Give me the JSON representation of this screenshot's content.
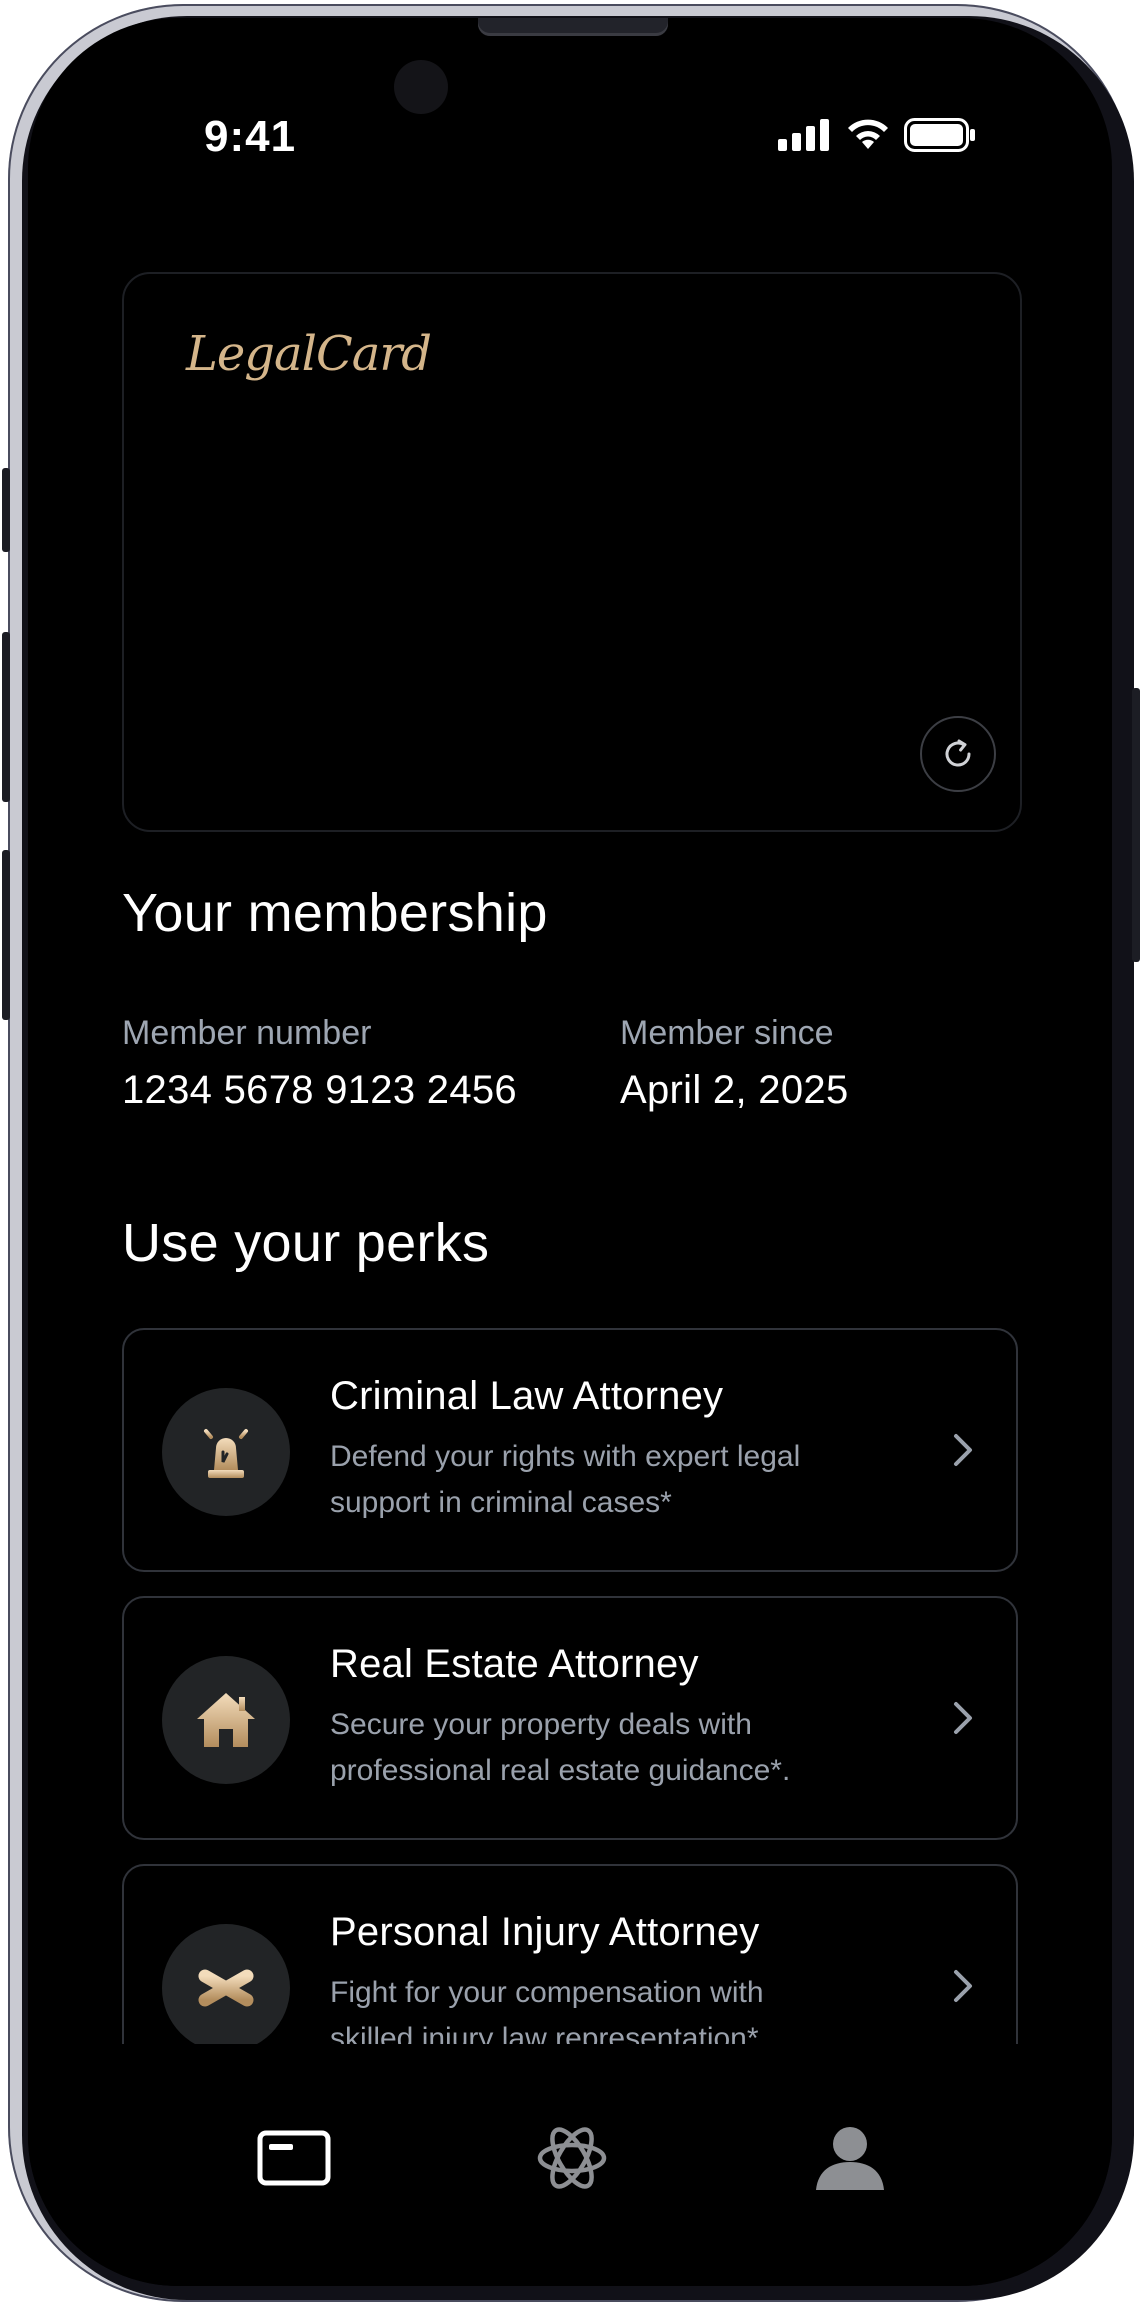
{
  "status_bar": {
    "time": "9:41"
  },
  "card": {
    "brand": "LegalCard",
    "refresh_icon": "refresh-icon"
  },
  "membership": {
    "heading": "Your membership",
    "member_number_label": "Member number",
    "member_number": "1234 5678 9123 2456",
    "member_since_label": "Member since",
    "member_since": "April 2, 2025"
  },
  "perks": {
    "heading": "Use your perks",
    "items": [
      {
        "title": "Criminal Law Attorney",
        "description": "Defend your rights with expert legal support in criminal cases*",
        "icon": "siren-icon"
      },
      {
        "title": "Real Estate Attorney",
        "description": "Secure your property deals with professional real estate guidance*.",
        "icon": "house-icon"
      },
      {
        "title": "Personal Injury Attorney",
        "description": "Fight for your compensation with skilled injury law representation*.",
        "icon": "asterisk-icon"
      }
    ]
  },
  "tab_bar": {
    "tabs": [
      "card-icon",
      "atom-icon",
      "person-icon"
    ]
  },
  "colors": {
    "accent_gold": "#d4b58a",
    "background": "#000000",
    "muted_text": "#9aa1ac"
  }
}
